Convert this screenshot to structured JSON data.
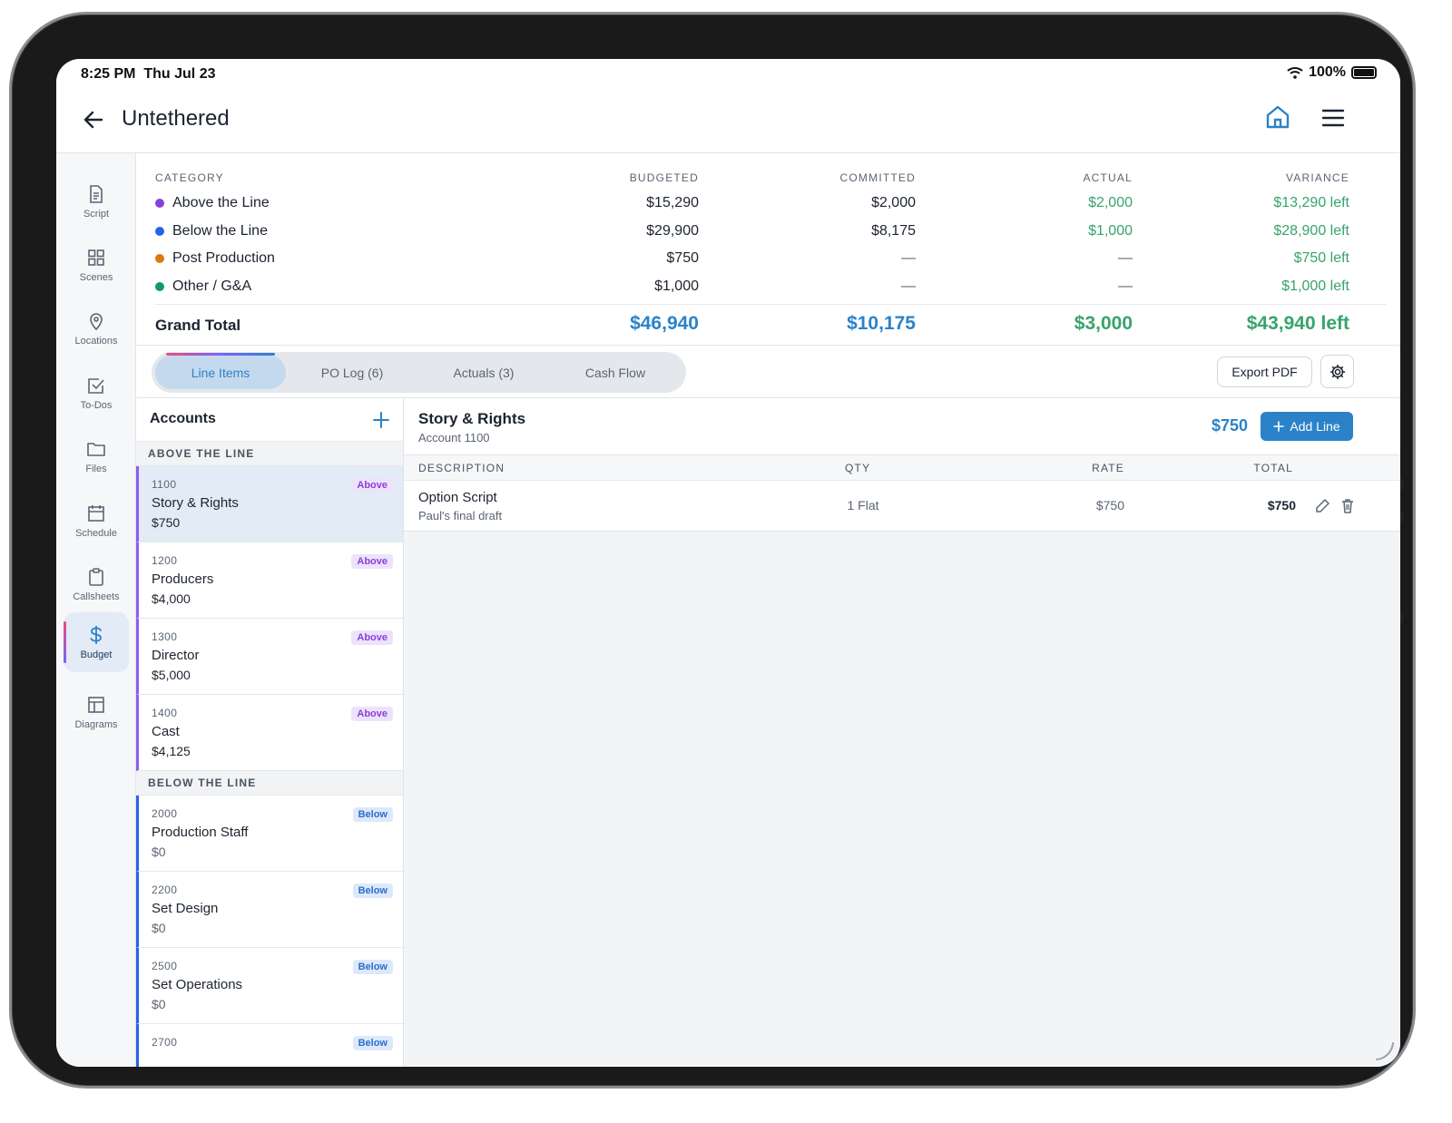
{
  "status": {
    "time": "8:25 PM",
    "date": "Thu Jul 23",
    "battery": "100%"
  },
  "header": {
    "title": "Untethered",
    "back_icon": "arrow-left-icon",
    "home_icon": "home-icon",
    "menu_icon": "hamburger-menu-icon"
  },
  "sidebar": {
    "items": [
      {
        "label": "Script",
        "icon": "document-icon"
      },
      {
        "label": "Scenes",
        "icon": "grid-icon"
      },
      {
        "label": "Locations",
        "icon": "map-pin-icon"
      },
      {
        "label": "To-Dos",
        "icon": "checkbox-icon"
      },
      {
        "label": "Files",
        "icon": "folder-icon"
      },
      {
        "label": "Schedule",
        "icon": "calendar-icon"
      },
      {
        "label": "Callsheets",
        "icon": "clipboard-icon"
      },
      {
        "label": "Budget",
        "icon": "dollar-icon",
        "active": true
      },
      {
        "label": "Diagrams",
        "icon": "layout-icon"
      }
    ]
  },
  "summary": {
    "headers": {
      "category": "CATEGORY",
      "budgeted": "BUDGETED",
      "committed": "COMMITTED",
      "actual": "ACTUAL",
      "variance": "VARIANCE"
    },
    "rows": [
      {
        "category": "Above the Line",
        "color": "#8b3fd9",
        "budgeted": "$15,290",
        "committed": "$2,000",
        "actual": "$2,000",
        "variance": "$13,290 left"
      },
      {
        "category": "Below the Line",
        "color": "#2563eb",
        "budgeted": "$29,900",
        "committed": "$8,175",
        "actual": "$1,000",
        "variance": "$28,900 left"
      },
      {
        "category": "Post Production",
        "color": "#d97a0e",
        "budgeted": "$750",
        "committed": "—",
        "actual": "—",
        "variance": "$750 left"
      },
      {
        "category": "Other / G&A",
        "color": "#0f9a6a",
        "budgeted": "$1,000",
        "committed": "—",
        "actual": "—",
        "variance": "$1,000 left"
      }
    ],
    "grand_total": {
      "label": "Grand Total",
      "budgeted": "$46,940",
      "committed": "$10,175",
      "actual": "$3,000",
      "variance": "$43,940 left"
    }
  },
  "tabs": [
    {
      "label": "Line Items",
      "active": true
    },
    {
      "label": "PO Log (6)"
    },
    {
      "label": "Actuals (3)"
    },
    {
      "label": "Cash Flow"
    }
  ],
  "toolbar": {
    "export_label": "Export PDF",
    "settings_icon": "gear-icon"
  },
  "accounts": {
    "title": "Accounts",
    "groups": [
      {
        "label": "ABOVE THE LINE",
        "items": [
          {
            "code": "1100",
            "name": "Story & Rights",
            "amount": "$750",
            "badge": "Above",
            "selected": true
          },
          {
            "code": "1200",
            "name": "Producers",
            "amount": "$4,000",
            "badge": "Above"
          },
          {
            "code": "1300",
            "name": "Director",
            "amount": "$5,000",
            "badge": "Above"
          },
          {
            "code": "1400",
            "name": "Cast",
            "amount": "$4,125",
            "badge": "Above"
          }
        ]
      },
      {
        "label": "BELOW THE LINE",
        "items": [
          {
            "code": "2000",
            "name": "Production Staff",
            "amount": "$0",
            "badge": "Below"
          },
          {
            "code": "2200",
            "name": "Set Design",
            "amount": "$0",
            "badge": "Below"
          },
          {
            "code": "2500",
            "name": "Set Operations",
            "amount": "$0",
            "badge": "Below"
          },
          {
            "code": "2700",
            "name": "",
            "amount": "",
            "badge": "Below"
          }
        ]
      }
    ]
  },
  "detail": {
    "title": "Story & Rights",
    "subtitle": "Account 1100",
    "total": "$750",
    "add_label": "Add Line",
    "columns": {
      "description": "DESCRIPTION",
      "qty": "QTY",
      "rate": "RATE",
      "total": "TOTAL"
    },
    "lines": [
      {
        "description": "Option Script",
        "note": "Paul's final draft",
        "qty": "1 Flat",
        "rate": "$750",
        "total": "$750"
      }
    ]
  }
}
